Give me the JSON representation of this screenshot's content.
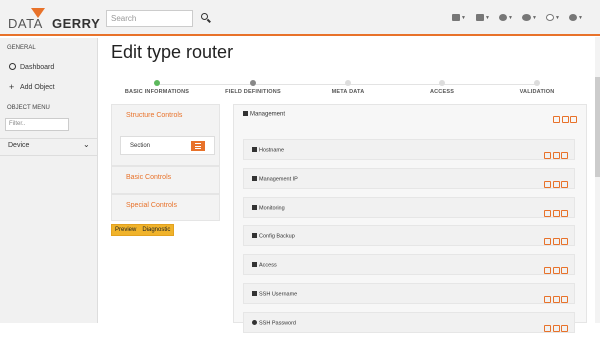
{
  "app": {
    "logo_left": "DATA",
    "logo_right": "GERRY"
  },
  "search": {
    "placeholder": "Search"
  },
  "toolbar": {
    "icons": [
      "map-icon",
      "list-icon",
      "dashboard-icon",
      "settings-icon",
      "help-icon",
      "user-icon"
    ]
  },
  "sidebar": {
    "general_label": "GENERAL",
    "dashboard_label": "Dashboard",
    "add_object_label": "Add Object",
    "object_menu_label": "OBJECT MENU",
    "filter_placeholder": "Filter..",
    "device_label": "Device"
  },
  "page": {
    "title": "Edit type router"
  },
  "steps": [
    {
      "label": "BASIC INFORMATIONS",
      "state": "done",
      "color": "#5cb85c"
    },
    {
      "label": "FIELD DEFINITIONS",
      "state": "current",
      "color": "#888888"
    },
    {
      "label": "META DATA",
      "state": "todo",
      "color": "#dddddd"
    },
    {
      "label": "ACCESS",
      "state": "todo",
      "color": "#dddddd"
    },
    {
      "label": "VALIDATION",
      "state": "todo",
      "color": "#dddddd"
    }
  ],
  "controls": {
    "structure_title": "Structure Controls",
    "section_label": "Section",
    "basic_title": "Basic Controls",
    "special_title": "Special Controls",
    "preview_tab": "Preview",
    "diagnostic_tab": "Diagnostic"
  },
  "section": {
    "title": "Management"
  },
  "fields": [
    {
      "name": "Hostname",
      "icon": "text-icon"
    },
    {
      "name": "Management IP",
      "icon": "text-icon"
    },
    {
      "name": "Monitoring",
      "icon": "checkbox-icon"
    },
    {
      "name": "Config Backup",
      "icon": "checkbox-icon"
    },
    {
      "name": "Access",
      "icon": "list-icon"
    },
    {
      "name": "SSH Username",
      "icon": "text-icon"
    },
    {
      "name": "SSH Password",
      "icon": "lock-icon"
    }
  ],
  "colors": {
    "accent": "#e8722a",
    "done": "#5cb85c",
    "tab": "#f0b32b"
  }
}
